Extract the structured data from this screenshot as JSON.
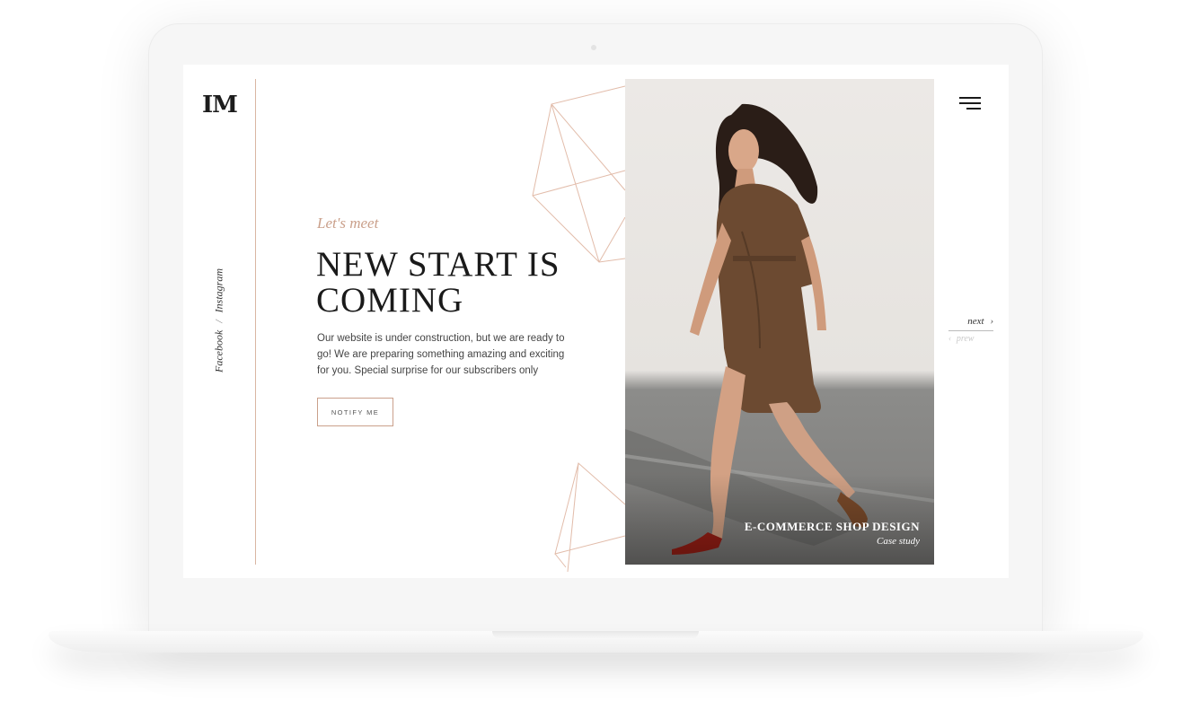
{
  "brand": {
    "logo": "IM"
  },
  "social": {
    "facebook": "Facebook",
    "separator": "/",
    "instagram": "Instagram"
  },
  "hero": {
    "pre_title": "Let's meet",
    "headline": "NEW START IS COMING",
    "description": "Our website is under construction, but we are ready to go! We are preparing something amazing and exciting for you. Special surprise for our subscribers only",
    "cta_label": "NOTIFY ME"
  },
  "showcase": {
    "title": "E-COMMERCE SHOP DESIGN",
    "subtitle": "Case study"
  },
  "nav": {
    "next_label": "next",
    "next_icon": "›",
    "prev_icon": "‹",
    "prev_label": "prew"
  },
  "colors": {
    "accent": "#caa08b",
    "text": "#1a1a1a",
    "line": "#d9b6a3"
  }
}
